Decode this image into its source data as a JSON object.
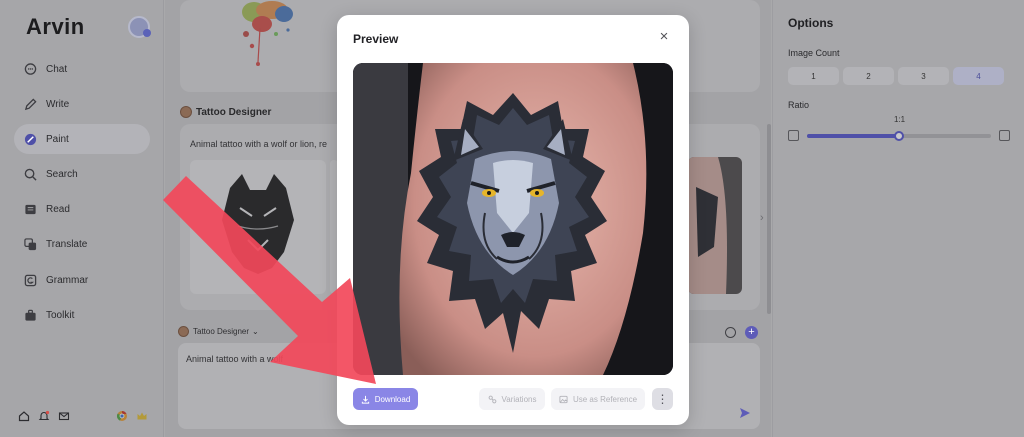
{
  "app": {
    "brand": "Arvin"
  },
  "sidebar": {
    "items": [
      {
        "label": "Chat",
        "icon": "chat-icon"
      },
      {
        "label": "Write",
        "icon": "write-icon"
      },
      {
        "label": "Paint",
        "icon": "paint-icon",
        "active": true
      },
      {
        "label": "Search",
        "icon": "search-icon"
      },
      {
        "label": "Read",
        "icon": "read-icon"
      },
      {
        "label": "Translate",
        "icon": "translate-icon"
      },
      {
        "label": "Grammar",
        "icon": "grammar-icon"
      },
      {
        "label": "Toolkit",
        "icon": "toolkit-icon"
      }
    ],
    "bottom_icons": [
      "home-icon",
      "bell-icon",
      "mail-icon",
      "chrome-icon",
      "crown-icon"
    ]
  },
  "chat": {
    "designer_name": "Tattoo Designer",
    "prompt_snippet": "Animal tattoo with a wolf or lion, re",
    "selector_label": "Tattoo Designer",
    "composer_text": "Animal tattoo with a wolf"
  },
  "options": {
    "title": "Options",
    "image_count_label": "Image Count",
    "counts": [
      "1",
      "2",
      "3",
      "4"
    ],
    "selected_count": "4",
    "ratio_label": "Ratio",
    "ratio_value": "1:1",
    "ratio_fraction": 0.5
  },
  "modal": {
    "title": "Preview",
    "close_symbol": "×",
    "download_label": "Download",
    "variations_label": "Variations",
    "reference_label": "Use as Reference",
    "more_symbol": "⋮"
  },
  "colors": {
    "accent": "#8a86e6",
    "annotation_arrow": "#f2485a"
  }
}
